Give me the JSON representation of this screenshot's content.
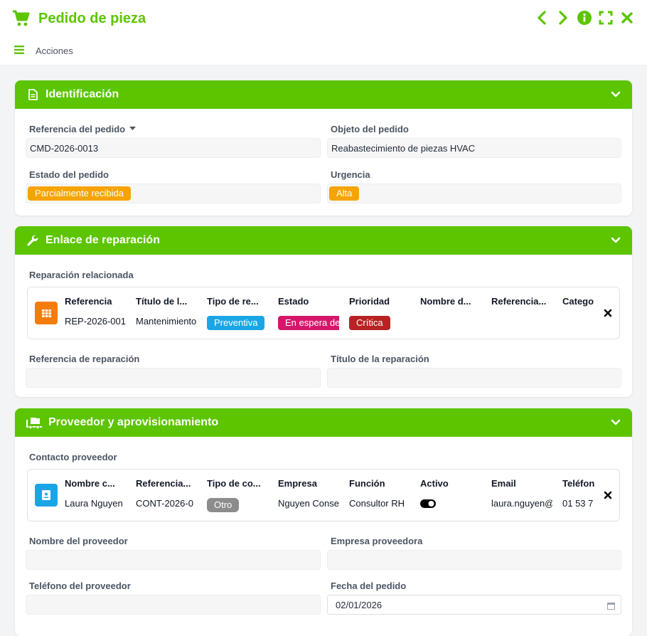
{
  "header": {
    "title": "Pedido de pieza",
    "actions_label": "Acciones"
  },
  "sections": {
    "identificacion": {
      "title": "Identificación",
      "fields": {
        "referencia_label": "Referencia del pedido",
        "referencia_value": "CMD-2026-0013",
        "objeto_label": "Objeto del pedido",
        "objeto_value": "Reabastecimiento de piezas HVAC",
        "estado_label": "Estado del pedido",
        "estado_value": "Parcialmente recibida",
        "urgencia_label": "Urgencia",
        "urgencia_value": "Alta"
      }
    },
    "reparacion": {
      "title": "Enlace de reparación",
      "related_label": "Reparación relacionada",
      "card": {
        "headers": [
          "Referencia",
          "Título de l...",
          "Tipo de re...",
          "Estado",
          "Prioridad",
          "Nombre d...",
          "Referencia...",
          "Catego"
        ],
        "values": [
          "REP-2026-001",
          "Mantenimiento",
          "Preventiva",
          "En espera de",
          "Crítica",
          "",
          "",
          ""
        ]
      },
      "ref_label": "Referencia de reparación",
      "ref_value": "",
      "titulo_label": "Título de la reparación",
      "titulo_value": ""
    },
    "proveedor": {
      "title": "Proveedor y aprovisionamiento",
      "contact_label": "Contacto proveedor",
      "card": {
        "headers": [
          "Nombre c...",
          "Referencia...",
          "Tipo de co...",
          "Empresa",
          "Función",
          "Activo",
          "Email",
          "Teléfon"
        ],
        "values": [
          "Laura Nguyen",
          "CONT-2026-0",
          "Otro",
          "Nguyen Conse",
          "Consultor RH",
          "",
          "laura.nguyen@",
          "01 53 7"
        ]
      },
      "nombre_label": "Nombre del proveedor",
      "nombre_value": "",
      "empresa_label": "Empresa proveedora",
      "empresa_value": "",
      "telefono_label": "Teléfono del proveedor",
      "telefono_value": "",
      "fecha_label": "Fecha del pedido",
      "fecha_value": "02/01/2026"
    }
  },
  "colors": {
    "brand": "#5cc500",
    "badge_orange": "#f5a400",
    "badge_blue": "#1aa6e6",
    "badge_pink": "#d6166b",
    "badge_red": "#b82222",
    "badge_gray": "#8c8c8c",
    "repair_icon_bg": "#f57c0b",
    "contact_icon_bg": "#1aa6e6"
  },
  "icons": {
    "title": "cart-icon",
    "nav_prev": "chevron-left-icon",
    "nav_next": "chevron-right-icon",
    "info": "info-icon",
    "fullscreen": "fullscreen-icon",
    "close": "close-icon",
    "menu": "hamburger-icon",
    "section1": "document-icon",
    "section2": "wrench-icon",
    "section3": "truck-icon",
    "repair_card": "grid-icon",
    "contact_card": "contact-card-icon"
  }
}
